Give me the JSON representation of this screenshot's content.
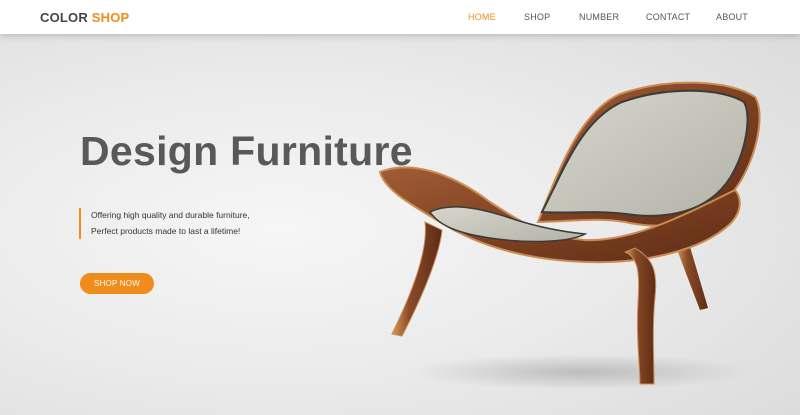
{
  "brand": {
    "name_part1": "COLOR",
    "name_part2": "SHOP",
    "accent_color": "#f08c1a"
  },
  "nav": {
    "items": [
      {
        "label": "HOME",
        "active": true
      },
      {
        "label": "SHOP",
        "active": false
      },
      {
        "label": "NUMBER",
        "active": false
      },
      {
        "label": "CONTACT",
        "active": false
      },
      {
        "label": "ABOUT",
        "active": false
      }
    ]
  },
  "hero": {
    "title": "Design Furniture",
    "tagline_line1": "Offering high quality and durable furniture,",
    "tagline_line2": "Perfect products made to last a lifetime!",
    "cta_label": "SHOP NOW",
    "image_subject": "shell-chair"
  }
}
